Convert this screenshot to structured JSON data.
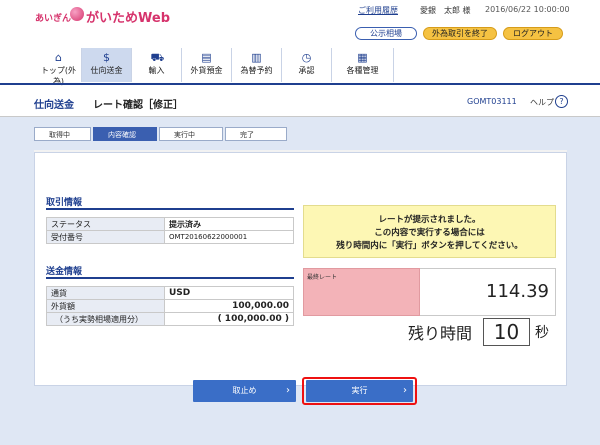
{
  "header": {
    "logo_small": "あいぎん",
    "logo_main": "がいためWeb",
    "links": [
      "ご利用履歴",
      "愛銀　太郎 様"
    ],
    "datetime": "2016/06/22 10:00:00",
    "buttons": {
      "rate": "公示相場",
      "fx_end": "外為取引を終了",
      "logout": "ログアウト"
    }
  },
  "nav": {
    "items": [
      {
        "label": "トップ(外為)",
        "icon": "home-icon"
      },
      {
        "label": "仕向送金",
        "icon": "remittance-icon"
      },
      {
        "label": "輸入",
        "icon": "import-icon"
      },
      {
        "label": "外貨預金",
        "icon": "deposit-icon"
      },
      {
        "label": "為替予約",
        "icon": "forward-contract-icon"
      },
      {
        "label": "承認",
        "icon": "approval-icon"
      },
      {
        "label": "各種管理",
        "icon": "management-icon"
      }
    ]
  },
  "page": {
    "section": "仕向送金",
    "name": "レート確認［修正］",
    "code": "GOMT03111",
    "help": "ヘルプ",
    "help_icon": "?"
  },
  "steps": [
    "取得中",
    "内容確認",
    "実行中",
    "完了"
  ],
  "trade": {
    "title": "取引情報",
    "rows": [
      {
        "k": "ステータス",
        "v": "提示済み"
      },
      {
        "k": "受付番号",
        "v": "OMT20160622000001"
      }
    ]
  },
  "remit": {
    "title": "送金情報",
    "rows": [
      {
        "k": "通貨",
        "v": "USD"
      },
      {
        "k": "外貨額",
        "v": "100,000.00"
      },
      {
        "k": "（うち実勢相場適用分）",
        "v": "( 100,000.00 )"
      }
    ]
  },
  "notice": {
    "line1": "レートが提示されました。",
    "line2": "この内容で実行する場合には",
    "line3": "残り時間内に「実行」ボタンを押してください。"
  },
  "rate": {
    "label": "最終レート",
    "value": "114.39"
  },
  "remaining": {
    "label": "残り時間",
    "value": "10",
    "unit": "秒"
  },
  "buttons": {
    "stop": "取止め",
    "exec": "実行",
    "chevron": "›"
  },
  "nav_icon_glyphs": [
    "⌂",
    "$",
    "⛟",
    "▤",
    "▥",
    "◷",
    "▦"
  ],
  "colors": {
    "brand": "#d6336c",
    "primary": "#1f3f8f",
    "button": "#3a6ec7",
    "highlight": "#e11111"
  }
}
